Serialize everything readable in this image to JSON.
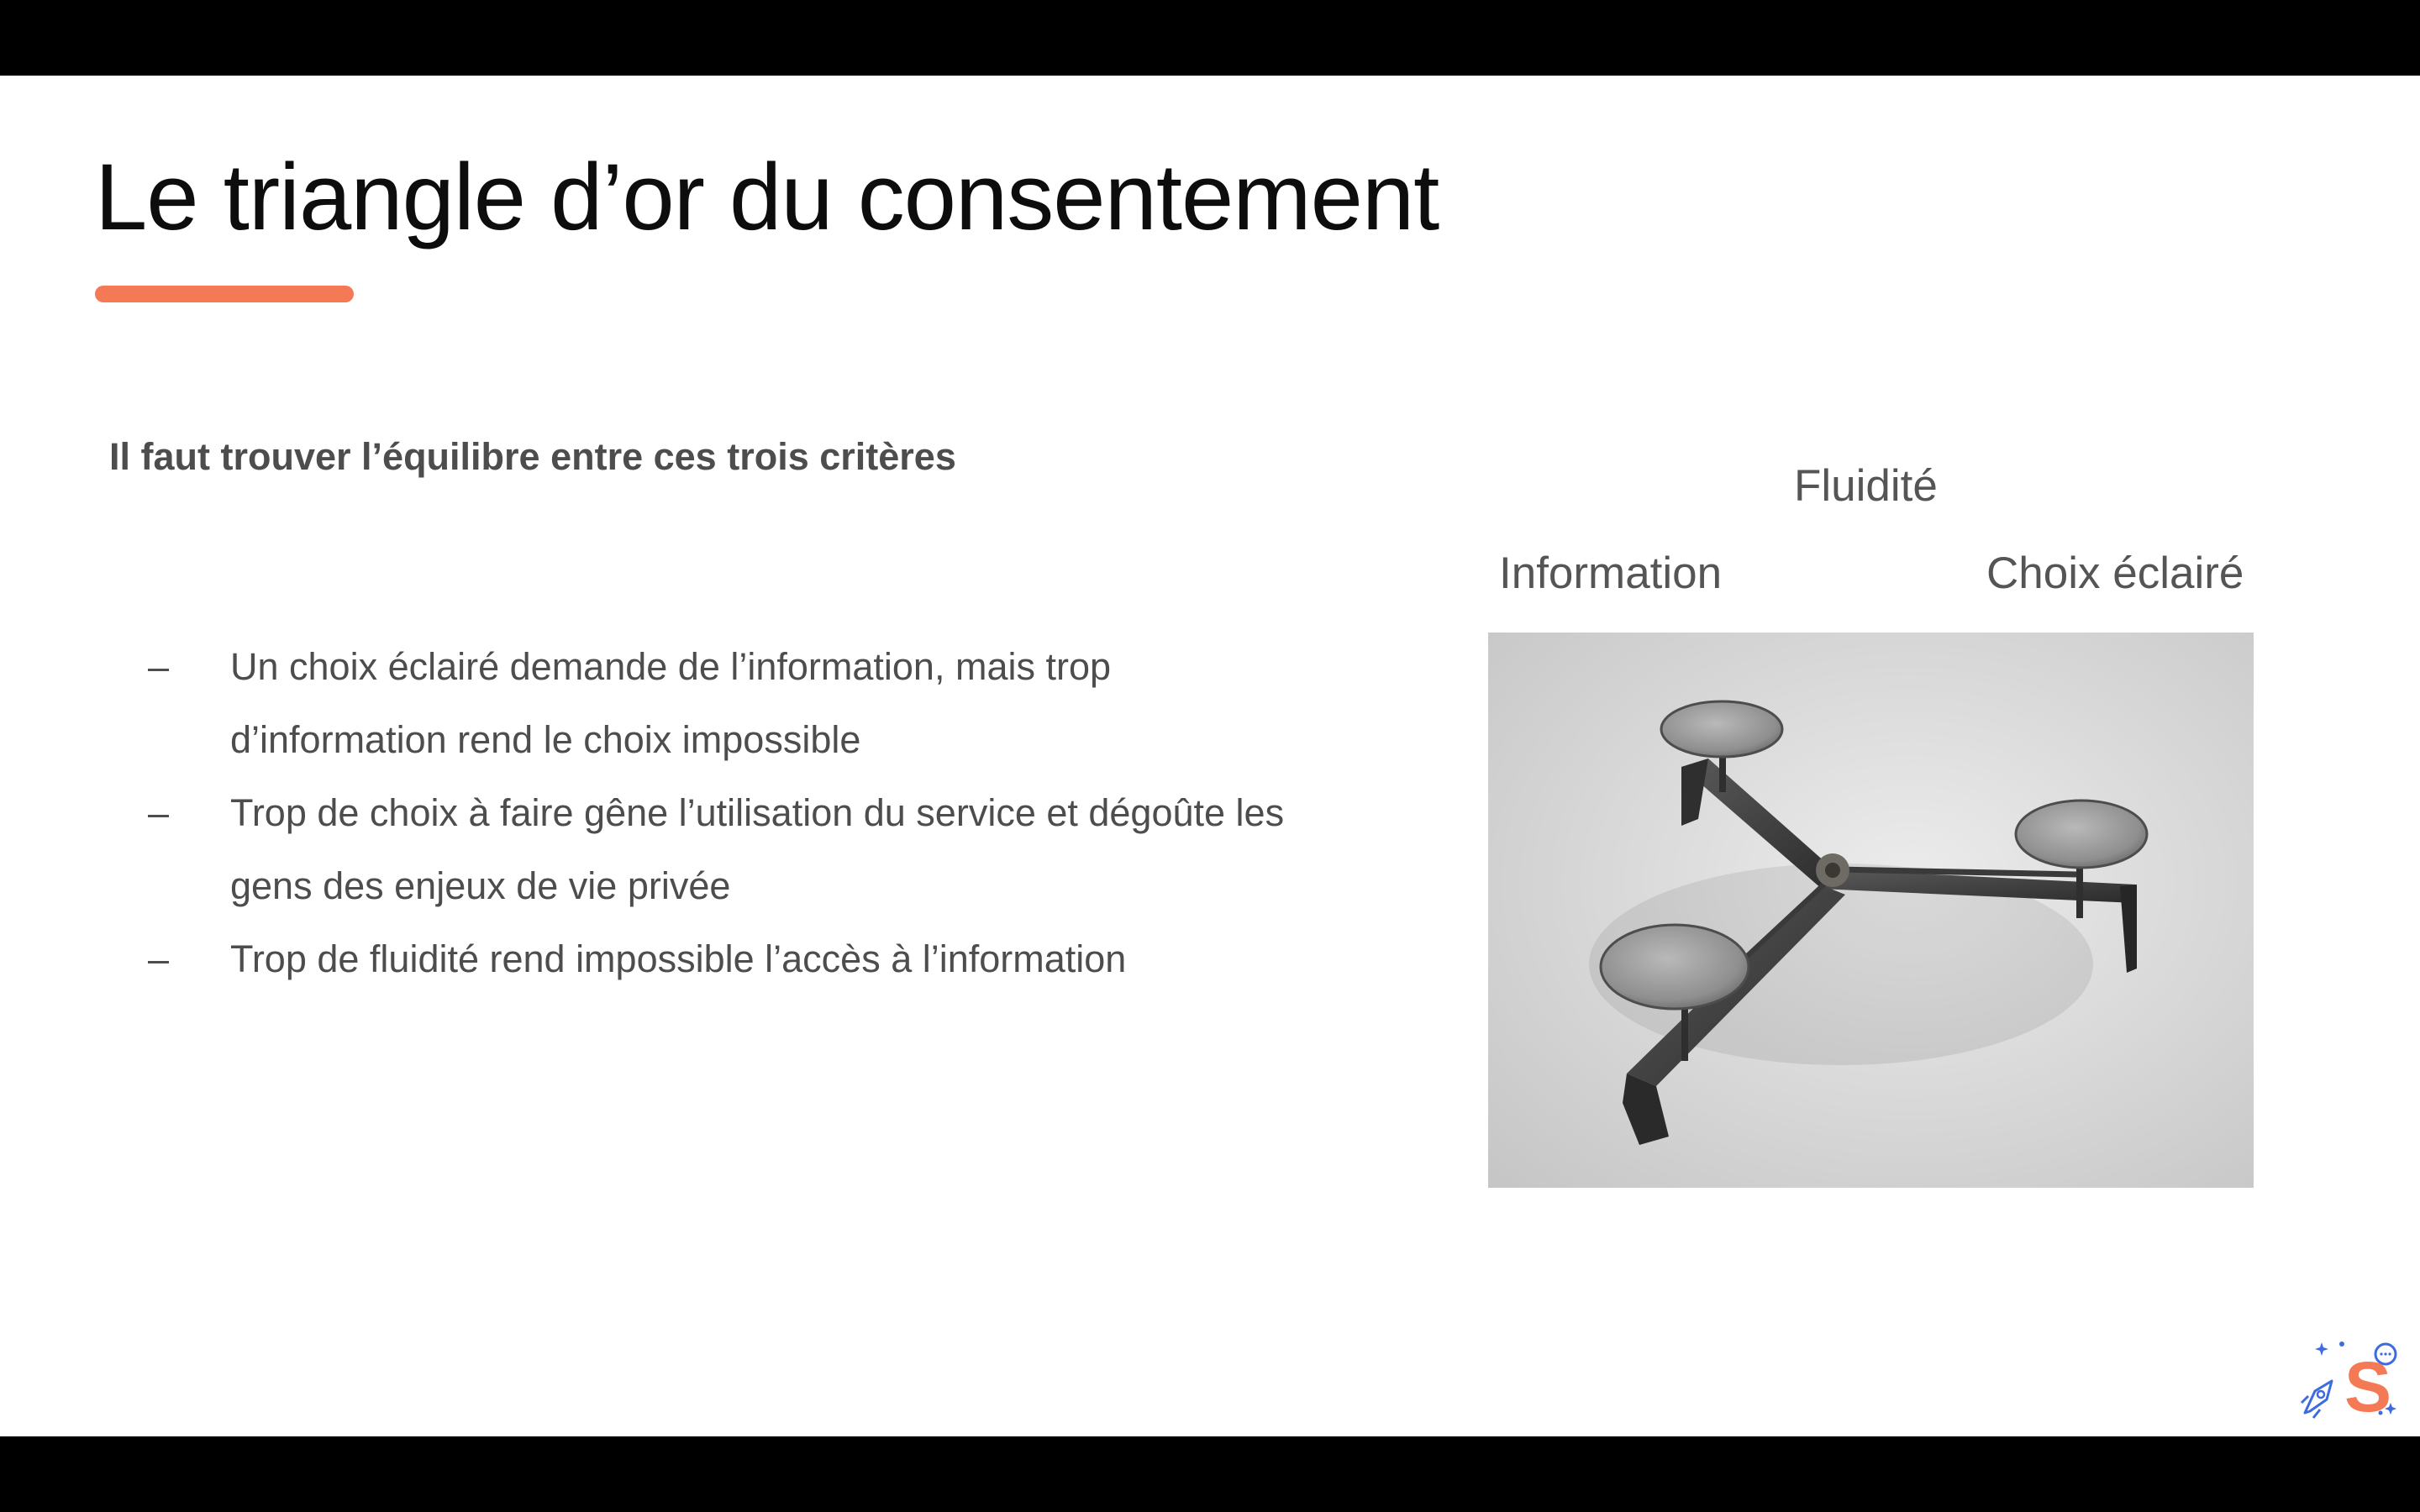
{
  "slide": {
    "title": "Le triangle d’or du consentement",
    "subtitle": "Il faut trouver l’équilibre entre ces trois critères",
    "bullet_dash": "–",
    "bullets": [
      "Un choix éclairé demande de l’information, mais trop d’information rend le choix impossible",
      "Trop de choix à faire gêne l’utilisation du service et dégoûte les gens des enjeux de vie privée",
      "Trop de fluidité rend impossible l’accès à l’information"
    ],
    "triangle_labels": {
      "top": "Fluidité",
      "left": "Information",
      "right": "Choix éclairé"
    },
    "photo_subject": "three-armed metal stand with three round trays",
    "logo_letter": "S"
  },
  "colors": {
    "accent": "#F47A55",
    "text": "#4D4D4D",
    "title": "#0D0D0D",
    "logo_blue": "#3D6BE0"
  },
  "icons": [
    "rocket-icon",
    "speech-bubble-icon",
    "sparkle-icon"
  ]
}
